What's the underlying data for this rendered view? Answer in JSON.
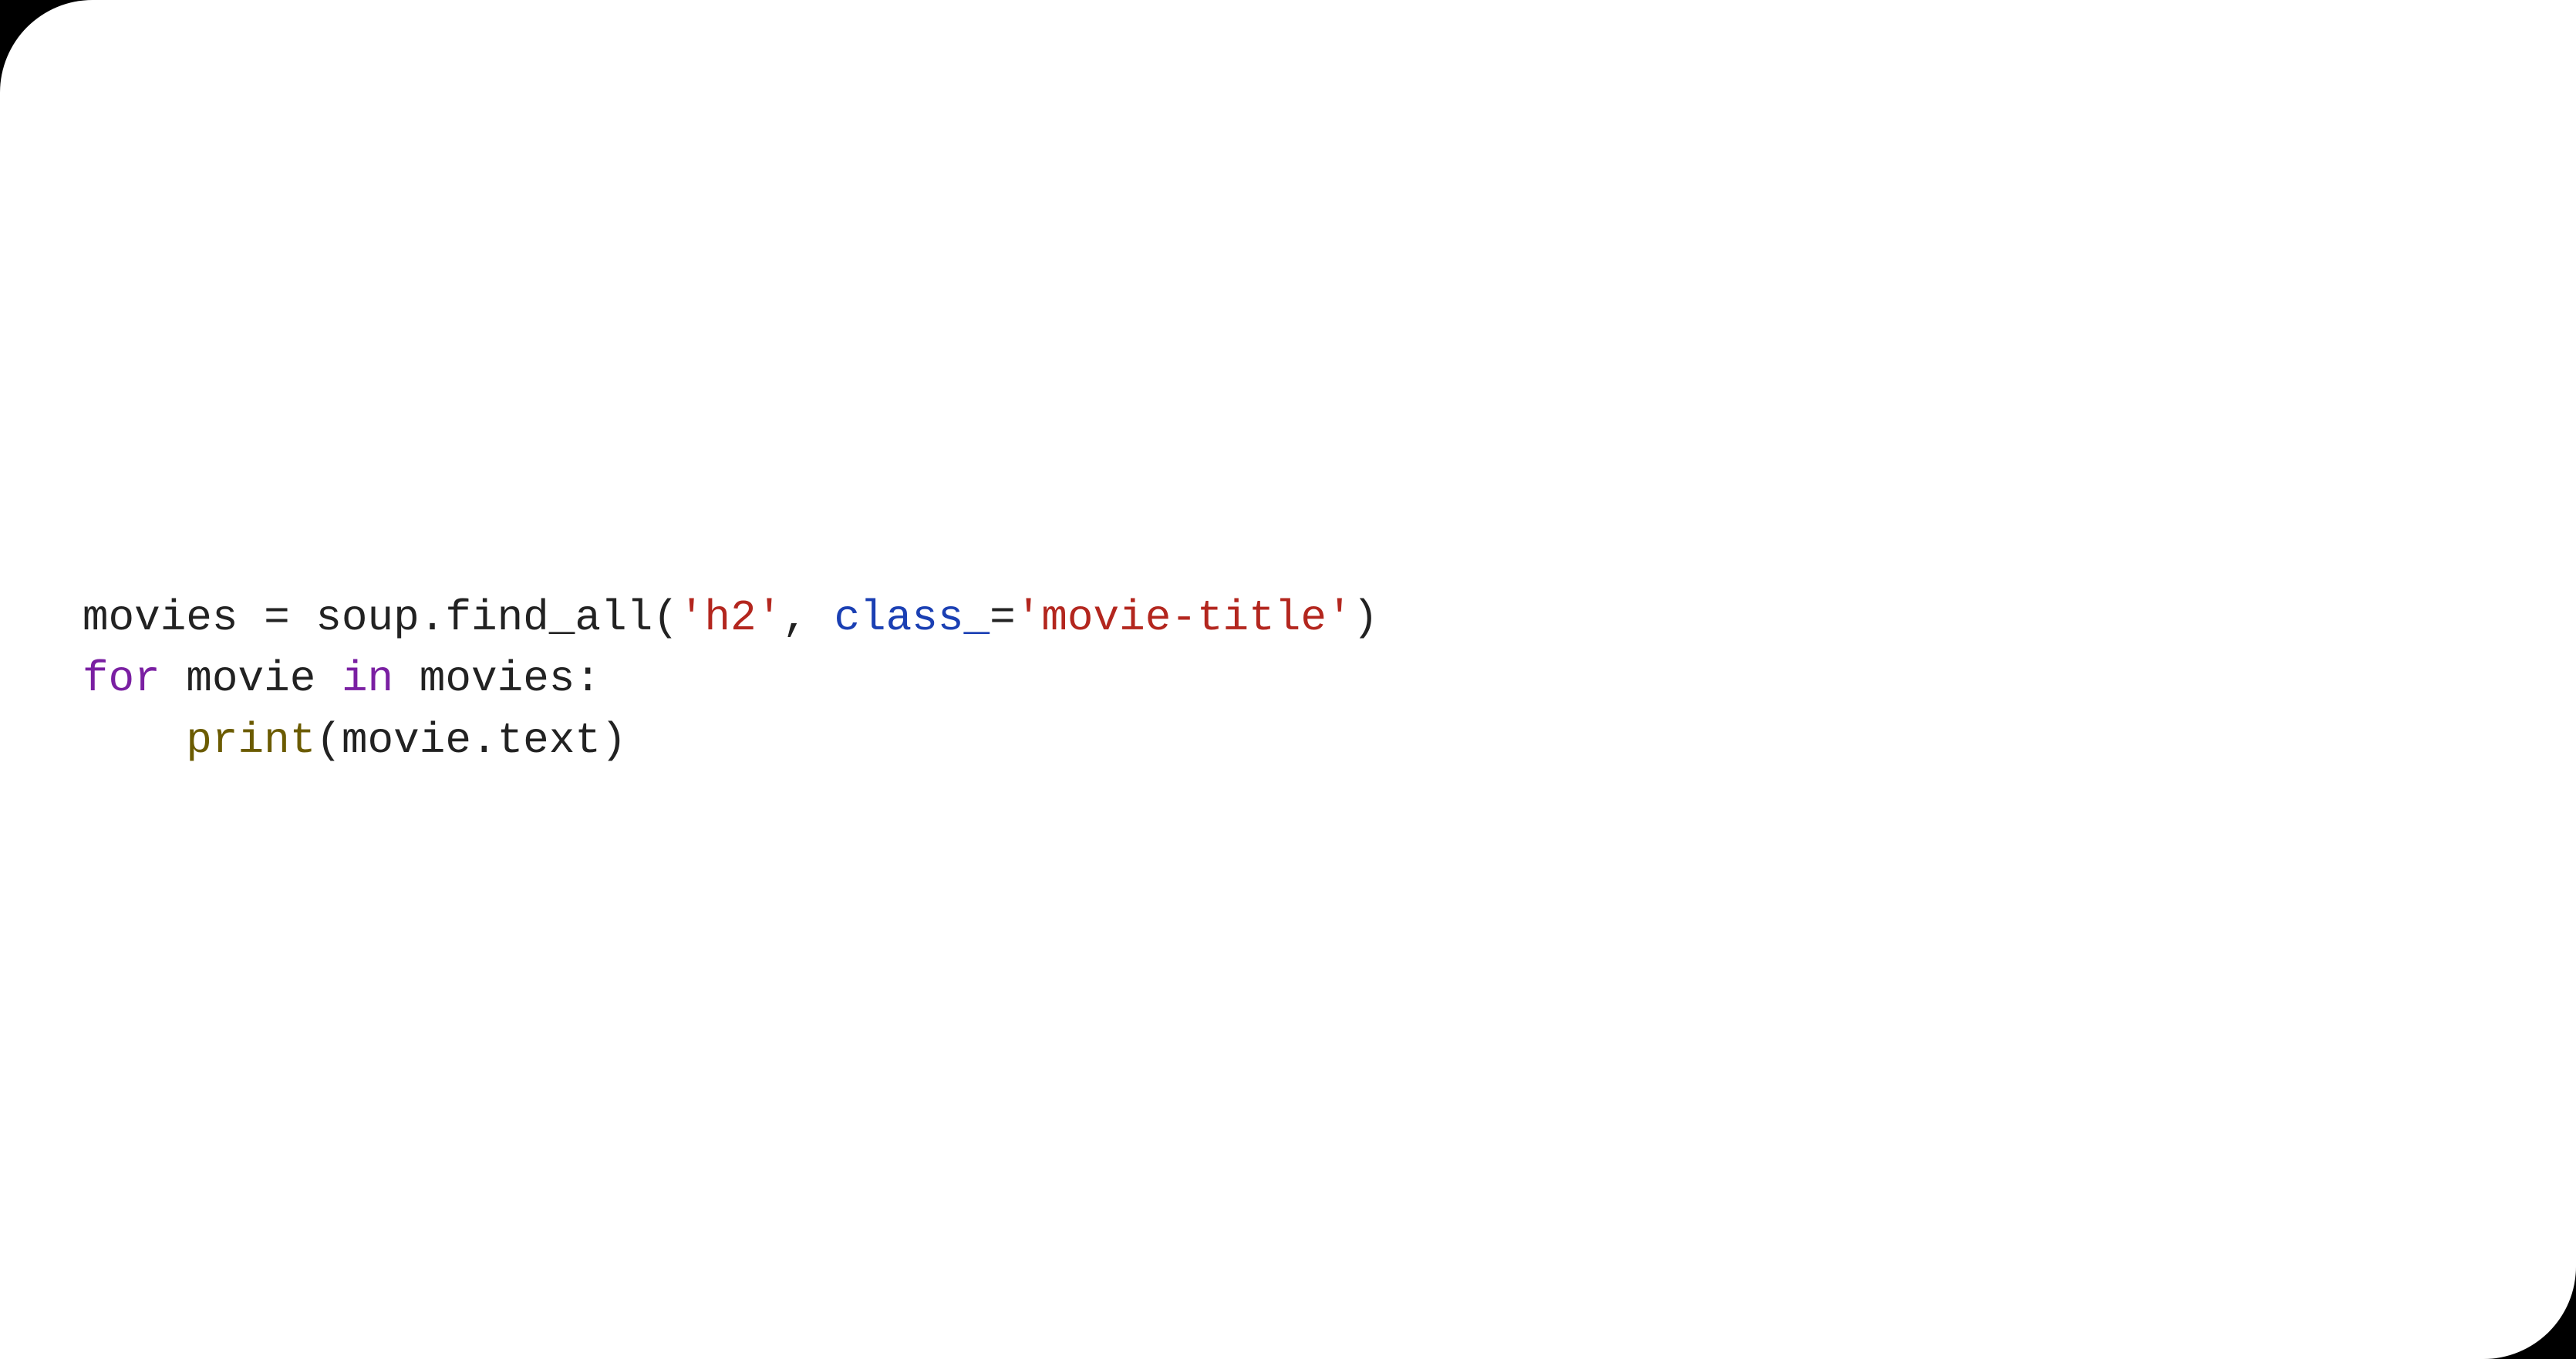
{
  "code": {
    "line1": {
      "t1": "movies = soup.find_all(",
      "s1": "'h2'",
      "t2": ", ",
      "p1": "class_",
      "t3": "=",
      "s2": "'movie-title'",
      "t4": ")"
    },
    "line2": {
      "k1": "for",
      "t1": " movie ",
      "k2": "in",
      "t2": " movies:"
    },
    "line3": {
      "indent": "    ",
      "b1": "print",
      "t1": "(movie.text)"
    }
  }
}
